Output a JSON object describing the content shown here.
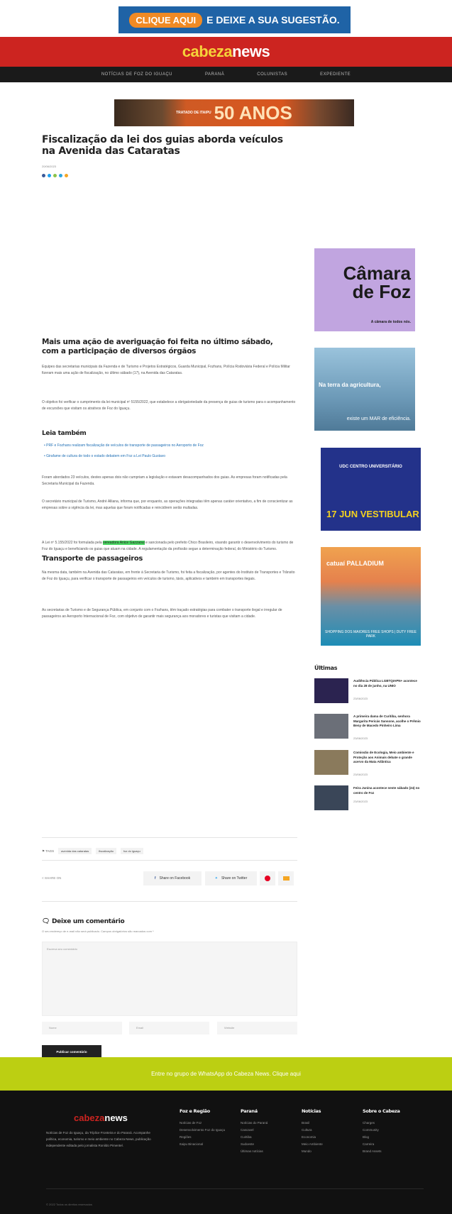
{
  "top_banner": {
    "cta": "CLIQUE AQUI",
    "text": "E DEIXE A SUA SUGESTÃO."
  },
  "header": {
    "logo_a": "cabeza",
    "logo_b": "news"
  },
  "nav": [
    "NOTÍCIAS DE FOZ DO IGUAÇU",
    "PARANÁ",
    "COLUNISTAS",
    "EXPEDIENTE"
  ],
  "anos_banner": {
    "small": "TRATADO DE ITAIPU",
    "big": "50 ANOS"
  },
  "article": {
    "title": "Fiscalização da lei dos guias aborda veículos na Avenida das Cataratas",
    "date": "20/06/2023",
    "h2": "Mais uma ação de averiguação foi feita no último sábado, com a participação de diversos órgãos",
    "p1": "Equipes das secretarias municipais da Fazenda e de Turismo e Projetos Estratégicos, Guarda Municipal, Fozhans, Polícia Rodoviária Federal e Polícia Militar fizeram mais uma ação de fiscalização, no último sábado (17), na Avenida das Cataratas.",
    "p2": "O objetivo foi verificar o cumprimento da lei municipal nº 5155/2022, que estabelece a obrigatoriedade da presença de guias de turismo para o acompanhamento de excursões que visitam os atrativos de Foz do Iguaçu.",
    "leia_title": "Leia também",
    "leia": [
      "PRF e Fozhans realizam fiscalização de veículos de transporte de passageiros no Aeroporto de Foz",
      "Girafame de cultura de todo o estado debatem em Foz a Lei Paulo Gustavo"
    ],
    "p3": "Foram abordados 23 veículos, destes apenas dois não cumpriam a legislação e estavam desacompanhados dos guias. As empresas foram notificadas pela Secretaria Municipal da Fazenda.",
    "p4": "O secretário municipal de Turismo, André Alliana, informa que, por enquanto, as operações integradas têm apenas caráter orientativo, a fim de conscientizar as empresas sobre a vigência da lei, mas aquelas que foram notificadas e reincidirem serão multadas.",
    "p5a": "A Lei nº 5.155/2022 foi formulada pela ",
    "p5hl": "vereadora Anice Gazzaoui",
    "p5b": " e sancionada pelo prefeito Chico Brasileiro, visando garantir o desenvolvimento do turismo de Foz do Iguaçu e beneficiando os guias que atuam na cidade. A regulamentação da profissão segue a determinação federal, do Ministério do Turismo.",
    "h3": "Transporte de passageiros",
    "p6": "Na mesma data, também na Avenida das Cataratas, em frente à Secretaria de Turismo, foi feita a fiscalização, por agentes do Instituto de Transportes e Trânsito de Foz do Iguaçu, para verificar o transporte de passageiros em veículos de turismo, táxis, aplicativos e também em transportes ilegais.",
    "p7": "As secretarias de Turismo e de Segurança Pública, em conjunto com o Fozhans, têm traçado estratégias para combater o transporte ilegal e irregular de passageiros ao Aeroporto Internacional de Foz, com objetivo de garantir mais segurança aos moradores e turistas que visitam a cidade."
  },
  "ads": {
    "camara": {
      "big_a": "Câmara",
      "big_b": "de Foz",
      "sub": "A câmara de todos nós."
    },
    "agri": {
      "t1": "Na terra da agricultura,",
      "t2": "existe um MAR de eficiência."
    },
    "udc": {
      "t1": "UDC CENTRO UNIVERSITÁRIO",
      "t2": "17 JUN VESTIBULAR"
    },
    "catuai": {
      "t1": "catuaí PALLADIUM",
      "t2": "SHOPPING DOS MAIORES FREE SHOPS | DUTY FREE PARK"
    }
  },
  "ultimas": {
    "title": "Últimas",
    "items": [
      {
        "title": "Audiência Pública LGBTQIAPN+ acontece no dia 28 de junho, na UNIO",
        "date": "23/06/2023",
        "color": "#2b2350"
      },
      {
        "title": "A primeira dama de Curitiba, senhora Margarita Pericás Sansone, acolhe o Prêmio Beny de Macedo Pinheiro Lima",
        "date": "23/06/2023",
        "color": "#6b6f78"
      },
      {
        "title": "Comissão de Ecologia, Meio ambiente e Proteção aos Animais debate o grande acervo da Mata Atlântica",
        "date": "23/06/2023",
        "color": "#8a7a5c"
      },
      {
        "title": "Feira Junina acontece neste sábado (24) no centro de Foz",
        "date": "23/06/2023",
        "color": "#3a4658"
      }
    ]
  },
  "tags": {
    "label": "TAGS",
    "items": [
      "avenida das cataratas",
      "fiscalização",
      "foz do iguaçu"
    ]
  },
  "share": {
    "label": "SHARE ON",
    "facebook": "Share on Facebook",
    "twitter": "Share on Twitter"
  },
  "comment": {
    "title": "Deixe um comentário",
    "note": "O seu endereço de e-mail não será publicado. Campos obrigatórios são marcados com *",
    "placeholder": "Escreva seu comentário",
    "name": "Nome",
    "email": "Email",
    "website": "Website",
    "submit": "Publicar comentário"
  },
  "whatsapp": "Entre no grupo de WhatsApp do Cabeza News. Clique aqui",
  "footer": {
    "logo_a": "cabeza",
    "logo_b": "news",
    "desc": "Notícias de Foz do Iguaçu, da Tríplice Fronteira e do Paraná. Acompanhe política, economia, turismo e meio ambiente no Cabeza News, publicação independente editada pelo jornalista Ronildo Pimentel.",
    "cols": [
      {
        "h": "Foz e Região",
        "items": [
          "Notícias de Foz",
          "Desenvolvimento Foz do Iguaçu",
          "Regiões",
          "Itaipu Binacional"
        ]
      },
      {
        "h": "Paraná",
        "items": [
          "Notícias do Paraná",
          "Cascavel",
          "Curitiba",
          "Sudoeste",
          "Últimas notícias"
        ]
      },
      {
        "h": "Notícias",
        "items": [
          "Brasil",
          "Cultura",
          "Economia",
          "Meio Ambiente",
          "Mundo"
        ]
      },
      {
        "h": "Sobre o Cabeza",
        "items": [
          "Charges",
          "Community",
          "Blog",
          "Carreira",
          "Brand Assets"
        ]
      }
    ],
    "copyright": "© 2022 Todos os direitos reservados"
  }
}
